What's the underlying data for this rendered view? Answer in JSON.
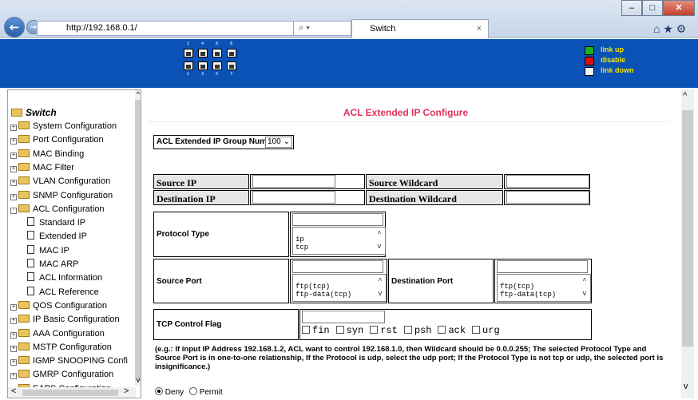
{
  "browser": {
    "url": "http://192.168.0.1/",
    "tab_title": "Switch",
    "tab_close": "×",
    "search_icon": "⌕ ▾",
    "nav_back": "←",
    "nav_forward": "→",
    "refresh": "↻",
    "home_star_gear": "⌂ ★ ⚙",
    "min": "–",
    "max": "□",
    "close": "✕"
  },
  "banner": {
    "port_numbers_top": [
      "2",
      "4",
      "6",
      "8"
    ],
    "port_numbers_bottom": [
      "1",
      "3",
      "5",
      "7"
    ],
    "legend": [
      {
        "label": "link up",
        "color": "#1bb31b"
      },
      {
        "label": "disable",
        "color": "#e01010"
      },
      {
        "label": "link down",
        "color": "#f4f4f4"
      }
    ]
  },
  "sidebar": {
    "root": "Switch",
    "items": [
      {
        "label": "System Configuration",
        "type": "folder"
      },
      {
        "label": "Port Configuration",
        "type": "folder"
      },
      {
        "label": "MAC Binding",
        "type": "folder"
      },
      {
        "label": "MAC Filter",
        "type": "folder"
      },
      {
        "label": "VLAN Configuration",
        "type": "folder"
      },
      {
        "label": "SNMP Configuration",
        "type": "folder"
      },
      {
        "label": "ACL Configuration",
        "type": "open"
      },
      {
        "label": "Standard IP",
        "type": "page"
      },
      {
        "label": "Extended IP",
        "type": "page"
      },
      {
        "label": "MAC IP",
        "type": "page"
      },
      {
        "label": "MAC ARP",
        "type": "page"
      },
      {
        "label": "ACL Information",
        "type": "page"
      },
      {
        "label": "ACL Reference",
        "type": "page"
      },
      {
        "label": "QOS Configuration",
        "type": "folder"
      },
      {
        "label": "IP Basic Configuration",
        "type": "folder"
      },
      {
        "label": "AAA Configuration",
        "type": "folder"
      },
      {
        "label": "MSTP Configuration",
        "type": "folder"
      },
      {
        "label": "IGMP SNOOPING Confi",
        "type": "folder"
      },
      {
        "label": "GMRP Configuration",
        "type": "folder"
      },
      {
        "label": "EAPS Configuration",
        "type": "folder"
      }
    ]
  },
  "main": {
    "title": "ACL Extended IP Configure",
    "group_label": "ACL Extended IP Group Num:",
    "group_value": "100",
    "source_ip": "Source IP",
    "source_wildcard": "Source Wildcard",
    "destination_ip": "Destination IP",
    "destination_wildcard": "Destination Wildcard",
    "protocol_type": "Protocol Type",
    "protocol_options": [
      "ip",
      "tcp"
    ],
    "source_port": "Source Port",
    "source_port_options": [
      "ftp(tcp)",
      "ftp-data(tcp)"
    ],
    "destination_port": "Destination Port",
    "destination_port_options": [
      "ftp(tcp)",
      "ftp-data(tcp)"
    ],
    "tcp_flag": "TCP Control Flag",
    "flags": [
      "fin",
      "syn",
      "rst",
      "psh",
      "ack",
      "urg"
    ],
    "note": "(e.g.: If input IP Address 192.168.1.2, ACL want to control 192.168.1.0, then Wildcard should be 0.0.0.255; The selected Protocol Type and Source Port is in one-to-one relationship, If the Protocol is udp, select the udp port; If the Protocol Type is not tcp or udp, the selected port is insignificance.)",
    "deny": "Deny",
    "permit": "Permit"
  }
}
